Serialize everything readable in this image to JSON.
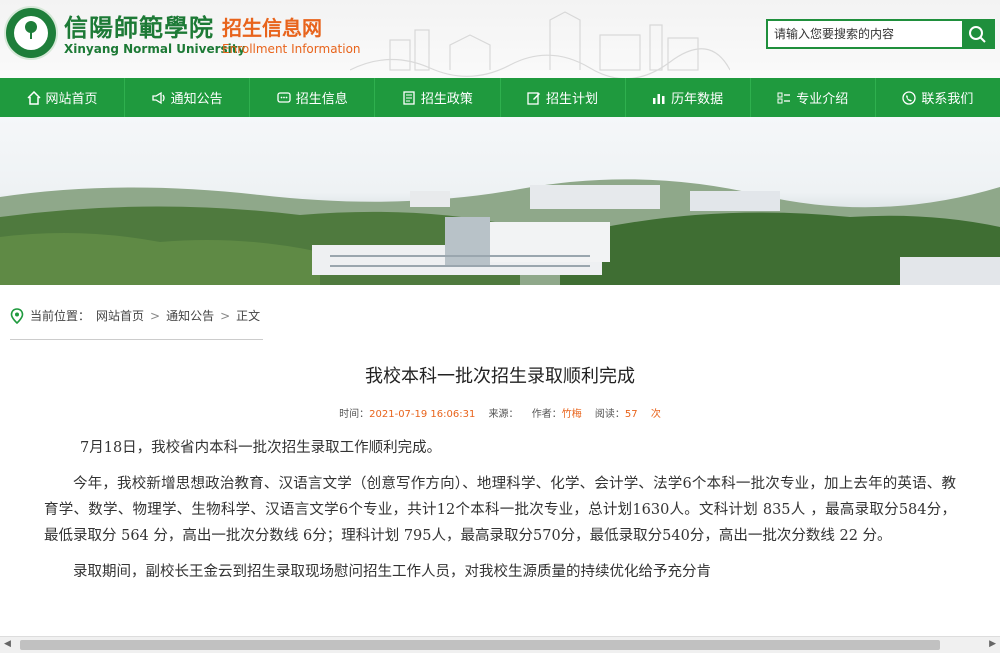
{
  "header": {
    "university_cn": "信陽師範學院",
    "university_en": "Xinyang Normal University",
    "site_cn": "招生信息网",
    "site_en": "Enrollment Information",
    "search_placeholder": "请输入您要搜索的内容"
  },
  "nav": [
    {
      "label": "网站首页",
      "icon": "home-icon"
    },
    {
      "label": "通知公告",
      "icon": "megaphone-icon"
    },
    {
      "label": "招生信息",
      "icon": "chat-icon"
    },
    {
      "label": "招生政策",
      "icon": "document-icon"
    },
    {
      "label": "招生计划",
      "icon": "edit-icon"
    },
    {
      "label": "历年数据",
      "icon": "bar-chart-icon"
    },
    {
      "label": "专业介绍",
      "icon": "list-icon"
    },
    {
      "label": "联系我们",
      "icon": "phone-icon"
    }
  ],
  "breadcrumb": {
    "prefix": "当前位置：",
    "home": "网站首页",
    "section": "通知公告",
    "current": "正文",
    "separator": ">"
  },
  "article": {
    "title": "我校本科一批次招生录取顺利完成",
    "meta_time_label": "时间：",
    "meta_time": "2021-07-19 16:06:31",
    "meta_source_label": "来源：",
    "meta_author_label": "作者：",
    "meta_author": "竹梅",
    "meta_reads_label": "阅读：",
    "meta_reads": "57",
    "meta_reads_unit": "次",
    "paragraphs": [
      "7月18日，我校省内本科一批次招生录取工作顺利完成。",
      "今年，我校新增思想政治教育、汉语言文学（创意写作方向）、地理科学、化学、会计学、法学6个本科一批次专业，加上去年的英语、教育学、数学、物理学、生物科学、汉语言文学6个专业，共计12个本科一批次专业，总计划1630人。文科计划 835人 ，最高录取分584分，最低录取分 564 分，高出一批次分数线 6分；理科计划 795人，最高录取分570分，最低录取分540分，高出一批次分数线 22 分。",
      "录取期间，副校长王金云到招生录取现场慰问招生工作人员，对我校生源质量的持续优化给予充分肯"
    ]
  },
  "colors": {
    "brand_green": "#1f9a3e",
    "accent_orange": "#e8641c"
  }
}
